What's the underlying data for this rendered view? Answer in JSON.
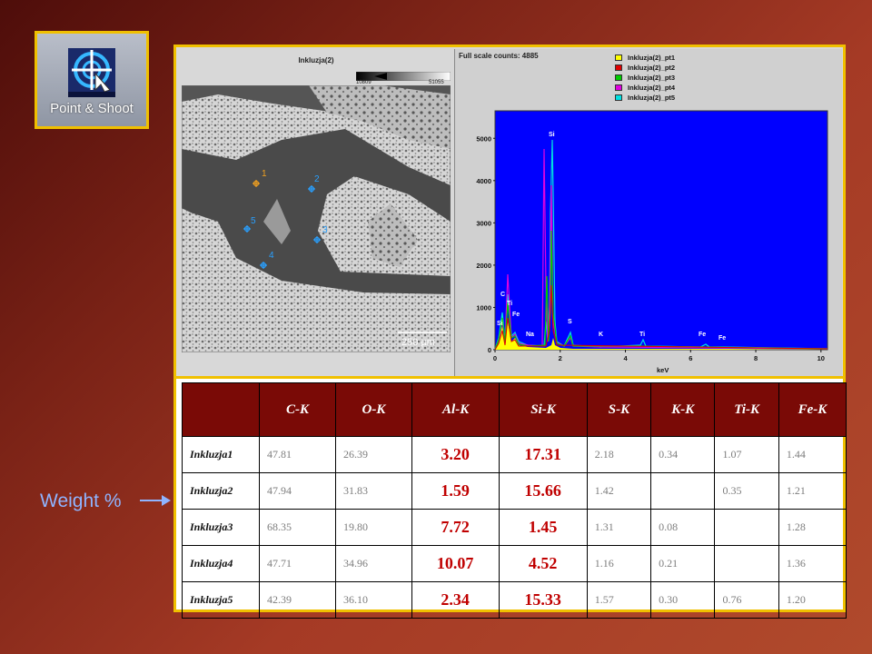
{
  "point_shoot": {
    "label": "Point & Shoot",
    "icon": "crosshair-target-icon"
  },
  "weight_label": "Weight %",
  "image_view": {
    "title": "Inkluzja(2)",
    "scale_min": "10809",
    "scale_max": "51055",
    "scale_bar_label": "250 µm",
    "points": [
      "1",
      "2",
      "3",
      "4",
      "5"
    ]
  },
  "spectrum": {
    "title": "Full scale counts: 4885",
    "legend": [
      {
        "name": "Inkluzja(2)_pt1",
        "color": "#ffff00"
      },
      {
        "name": "Inkluzja(2)_pt2",
        "color": "#e00000"
      },
      {
        "name": "Inkluzja(2)_pt3",
        "color": "#00cc00"
      },
      {
        "name": "Inkluzja(2)_pt4",
        "color": "#e000e0"
      },
      {
        "name": "Inkluzja(2)_pt5",
        "color": "#00e0e0"
      }
    ],
    "y_ticks": [
      "0",
      "1000",
      "2000",
      "3000",
      "4000",
      "5000"
    ],
    "x_ticks": [
      "0",
      "2",
      "4",
      "6",
      "8",
      "10"
    ],
    "x_label": "keV",
    "peak_labels": [
      "Si",
      "C",
      "Ti",
      "Fe",
      "Si",
      "Na",
      "S",
      "K",
      "Ti",
      "Fe",
      "Fe"
    ],
    "plot_bg": "#0000ff"
  },
  "table": {
    "headers": [
      "",
      "C-K",
      "O-K",
      "Al-K",
      "Si-K",
      "S-K",
      "K-K",
      "Ti-K",
      "Fe-K"
    ],
    "rows": [
      [
        "Inkluzja1",
        "47.81",
        "26.39",
        "3.20",
        "17.31",
        "2.18",
        "0.34",
        "1.07",
        "1.44"
      ],
      [
        "Inkluzja2",
        "47.94",
        "31.83",
        "1.59",
        "15.66",
        "1.42",
        "",
        "0.35",
        "1.21"
      ],
      [
        "Inkluzja3",
        "68.35",
        "19.80",
        "7.72",
        "1.45",
        "1.31",
        "0.08",
        "",
        "1.28"
      ],
      [
        "Inkluzja4",
        "47.71",
        "34.96",
        "10.07",
        "4.52",
        "1.16",
        "0.21",
        "",
        "1.36"
      ],
      [
        "Inkluzja5",
        "42.39",
        "36.10",
        "2.34",
        "15.33",
        "1.57",
        "0.30",
        "0.76",
        "1.20"
      ]
    ]
  }
}
